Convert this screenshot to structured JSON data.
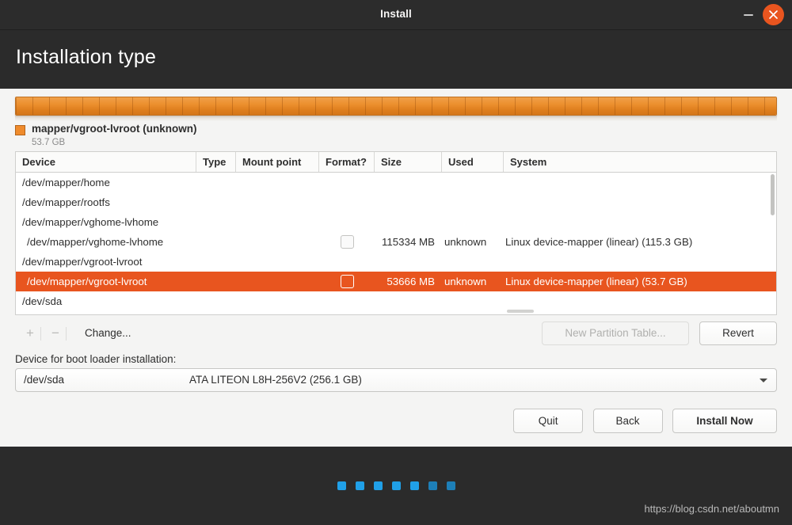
{
  "window": {
    "title": "Install",
    "minimize_icon": "minimize-icon",
    "close_icon": "close-icon"
  },
  "page": {
    "heading": "Installation type"
  },
  "partition_bar": {
    "legend_title": "mapper/vgroot-lvroot (unknown)",
    "legend_size": "53.7 GB",
    "swatch_color": "#ef8b2c",
    "bar_color": "#ec8f2e"
  },
  "table": {
    "columns": [
      {
        "key": "device",
        "label": "Device"
      },
      {
        "key": "type",
        "label": "Type"
      },
      {
        "key": "mount",
        "label": "Mount point"
      },
      {
        "key": "format",
        "label": "Format?"
      },
      {
        "key": "size",
        "label": "Size"
      },
      {
        "key": "used",
        "label": "Used"
      },
      {
        "key": "system",
        "label": "System"
      }
    ],
    "rows": [
      {
        "device": "/dev/mapper/home",
        "type": "",
        "mount": "",
        "format": false,
        "has_format": false,
        "size": "",
        "used": "",
        "system": "",
        "indent": false,
        "selected": false
      },
      {
        "device": "/dev/mapper/rootfs",
        "type": "",
        "mount": "",
        "format": false,
        "has_format": false,
        "size": "",
        "used": "",
        "system": "",
        "indent": false,
        "selected": false
      },
      {
        "device": "/dev/mapper/vghome-lvhome",
        "type": "",
        "mount": "",
        "format": false,
        "has_format": false,
        "size": "",
        "used": "",
        "system": "",
        "indent": false,
        "selected": false
      },
      {
        "device": "/dev/mapper/vghome-lvhome",
        "type": "",
        "mount": "",
        "format": false,
        "has_format": true,
        "size": "115334 MB",
        "used": "unknown",
        "system": "Linux device-mapper (linear) (115.3 GB)",
        "indent": true,
        "selected": false
      },
      {
        "device": "/dev/mapper/vgroot-lvroot",
        "type": "",
        "mount": "",
        "format": false,
        "has_format": false,
        "size": "",
        "used": "",
        "system": "",
        "indent": false,
        "selected": false
      },
      {
        "device": "/dev/mapper/vgroot-lvroot",
        "type": "",
        "mount": "",
        "format": false,
        "has_format": true,
        "size": "53666 MB",
        "used": "unknown",
        "system": "Linux device-mapper (linear) (53.7 GB)",
        "indent": true,
        "selected": true
      },
      {
        "device": "/dev/sda",
        "type": "",
        "mount": "",
        "format": false,
        "has_format": false,
        "size": "",
        "used": "",
        "system": "",
        "indent": false,
        "selected": false
      }
    ],
    "selection_color": "#e8551f"
  },
  "toolbar": {
    "add_label": "+",
    "remove_label": "−",
    "change_label": "Change...",
    "new_partition_table_label": "New Partition Table...",
    "revert_label": "Revert"
  },
  "bootloader": {
    "label": "Device for boot loader installation:",
    "selected_device": "/dev/sda",
    "selected_description": "ATA LITEON L8H-256V2 (256.1 GB)"
  },
  "footer": {
    "quit_label": "Quit",
    "back_label": "Back",
    "install_label": "Install Now"
  },
  "progress": {
    "total_dots": 7,
    "active_dots": 5,
    "active_color": "#20a0e8",
    "inactive_color": "#1d7fb8"
  },
  "watermark": {
    "text": "https://blog.csdn.net/aboutmn"
  }
}
